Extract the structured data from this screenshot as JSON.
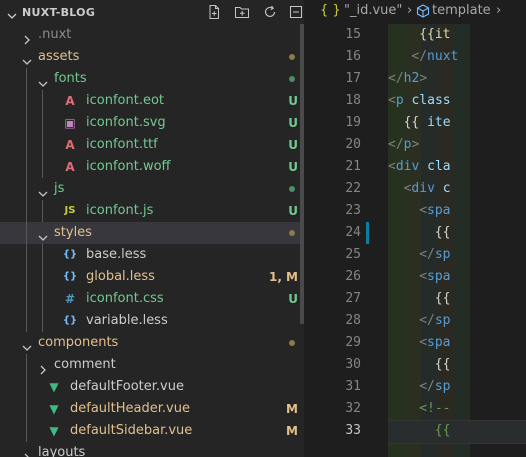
{
  "explorer": {
    "title": "NUXT-BLOG",
    "tree": [
      {
        "label": "nuxt",
        "prefix": ".",
        "depth": 0,
        "chevron": "right",
        "color": "#8c8c8c",
        "icon": null,
        "badge": "",
        "dot": null,
        "active": false
      },
      {
        "label": "assets",
        "depth": 0,
        "chevron": "down",
        "color": "#e2c08d",
        "icon": null,
        "badge": "",
        "dot": "#8c7a4a",
        "active": false
      },
      {
        "label": "fonts",
        "depth": 1,
        "chevron": "down",
        "color": "#73c991",
        "icon": null,
        "badge": "",
        "dot": "#4d8f63",
        "active": false
      },
      {
        "label": "iconfont.eot",
        "depth": 2,
        "chevron": null,
        "color": "#73c991",
        "icon": "font-file-icon",
        "badge": "U",
        "dot": null,
        "active": false
      },
      {
        "label": "iconfont.svg",
        "depth": 2,
        "chevron": null,
        "color": "#73c991",
        "icon": "svg-file-icon",
        "badge": "U",
        "dot": null,
        "active": false
      },
      {
        "label": "iconfont.ttf",
        "depth": 2,
        "chevron": null,
        "color": "#73c991",
        "icon": "font-file-icon",
        "badge": "U",
        "dot": null,
        "active": false
      },
      {
        "label": "iconfont.woff",
        "depth": 2,
        "chevron": null,
        "color": "#73c991",
        "icon": "font-file-icon",
        "badge": "U",
        "dot": null,
        "active": false
      },
      {
        "label": "js",
        "depth": 1,
        "chevron": "down",
        "color": "#73c991",
        "icon": null,
        "badge": "",
        "dot": "#4d8f63",
        "active": false
      },
      {
        "label": "iconfont.js",
        "depth": 2,
        "chevron": null,
        "color": "#73c991",
        "icon": "js-file-icon",
        "badge": "U",
        "dot": null,
        "active": false
      },
      {
        "label": "styles",
        "depth": 1,
        "chevron": "down",
        "color": "#e2c08d",
        "icon": null,
        "badge": "",
        "dot": "#8c7a4a",
        "active": true
      },
      {
        "label": "base.less",
        "depth": 2,
        "chevron": null,
        "color": "#cccccc",
        "icon": "less-file-icon",
        "badge": "",
        "dot": null,
        "active": false
      },
      {
        "label": "global.less",
        "depth": 2,
        "chevron": null,
        "color": "#e2c08d",
        "icon": "less-file-icon",
        "badge": "1, M",
        "dot": null,
        "active": false
      },
      {
        "label": "iconfont.css",
        "depth": 2,
        "chevron": null,
        "color": "#73c991",
        "icon": "css-file-icon",
        "badge": "U",
        "dot": null,
        "active": false
      },
      {
        "label": "variable.less",
        "depth": 2,
        "chevron": null,
        "color": "#cccccc",
        "icon": "less-file-icon",
        "badge": "",
        "dot": null,
        "active": false
      },
      {
        "label": "components",
        "depth": 0,
        "chevron": "down",
        "color": "#e2c08d",
        "icon": null,
        "badge": "",
        "dot": "#8c7a4a",
        "active": false
      },
      {
        "label": "comment",
        "depth": 1,
        "chevron": "right",
        "color": "#cccccc",
        "icon": null,
        "badge": "",
        "dot": null,
        "active": false
      },
      {
        "label": "defaultFooter.vue",
        "depth": 1,
        "chevron": null,
        "color": "#cccccc",
        "icon": "vue-file-icon",
        "badge": "",
        "dot": null,
        "active": false
      },
      {
        "label": "defaultHeader.vue",
        "depth": 1,
        "chevron": null,
        "color": "#e2c08d",
        "icon": "vue-file-icon",
        "badge": "M",
        "dot": null,
        "active": false
      },
      {
        "label": "defaultSidebar.vue",
        "depth": 1,
        "chevron": null,
        "color": "#e2c08d",
        "icon": "vue-file-icon",
        "badge": "M",
        "dot": null,
        "active": false
      },
      {
        "label": "layouts",
        "depth": 0,
        "chevron": "right",
        "color": "#cccccc",
        "icon": null,
        "badge": "",
        "dot": null,
        "active": false
      }
    ]
  },
  "editor": {
    "breadcrumb": {
      "file_icon": "{ }",
      "file": "\"_id.vue\"",
      "separator": "›",
      "node_icon": "cube-icon",
      "node": "template",
      "separator2": "›"
    },
    "lines": [
      {
        "n": "15",
        "indent": 4,
        "segs": [
          [
            "{{it",
            "#dcdcaa"
          ]
        ]
      },
      {
        "n": "16",
        "indent": 3,
        "segs": [
          [
            "</",
            "#808080"
          ],
          [
            "nuxt",
            "#569cd6"
          ]
        ]
      },
      {
        "n": "17",
        "indent": 0,
        "segs": [
          [
            "</",
            "#808080"
          ],
          [
            "h2",
            "#569cd6"
          ],
          [
            ">",
            "#808080"
          ]
        ]
      },
      {
        "n": "18",
        "indent": 0,
        "segs": [
          [
            "<",
            "#808080"
          ],
          [
            "p",
            "#569cd6"
          ],
          [
            " class",
            "#9cdcfe"
          ]
        ]
      },
      {
        "n": "19",
        "indent": 2,
        "segs": [
          [
            "{{",
            "#d4d4d4"
          ],
          [
            " ite",
            "#9cdcfe"
          ]
        ]
      },
      {
        "n": "20",
        "indent": 0,
        "segs": [
          [
            "</",
            "#808080"
          ],
          [
            "p",
            "#569cd6"
          ],
          [
            ">",
            "#808080"
          ]
        ]
      },
      {
        "n": "21",
        "indent": 0,
        "segs": [
          [
            "<",
            "#808080"
          ],
          [
            "div",
            "#569cd6"
          ],
          [
            " cla",
            "#9cdcfe"
          ]
        ]
      },
      {
        "n": "22",
        "indent": 2,
        "segs": [
          [
            "<",
            "#808080"
          ],
          [
            "div",
            "#569cd6"
          ],
          [
            " c",
            "#9cdcfe"
          ]
        ]
      },
      {
        "n": "23",
        "indent": 4,
        "segs": [
          [
            "<",
            "#808080"
          ],
          [
            "spa",
            "#569cd6"
          ]
        ]
      },
      {
        "n": "24",
        "indent": 6,
        "segs": [
          [
            "{{",
            "#d4d4d4"
          ]
        ]
      },
      {
        "n": "25",
        "indent": 4,
        "segs": [
          [
            "</",
            "#808080"
          ],
          [
            "sp",
            "#569cd6"
          ]
        ]
      },
      {
        "n": "26",
        "indent": 4,
        "segs": [
          [
            "<",
            "#808080"
          ],
          [
            "spa",
            "#569cd6"
          ]
        ]
      },
      {
        "n": "27",
        "indent": 6,
        "segs": [
          [
            "{{",
            "#d4d4d4"
          ]
        ]
      },
      {
        "n": "28",
        "indent": 4,
        "segs": [
          [
            "</",
            "#808080"
          ],
          [
            "sp",
            "#569cd6"
          ]
        ]
      },
      {
        "n": "29",
        "indent": 4,
        "segs": [
          [
            "<",
            "#808080"
          ],
          [
            "spa",
            "#569cd6"
          ]
        ]
      },
      {
        "n": "30",
        "indent": 6,
        "segs": [
          [
            "{{",
            "#d4d4d4"
          ]
        ]
      },
      {
        "n": "31",
        "indent": 4,
        "segs": [
          [
            "</",
            "#808080"
          ],
          [
            "sp",
            "#569cd6"
          ]
        ]
      },
      {
        "n": "32",
        "indent": 4,
        "segs": [
          [
            "<!--",
            "#6a9955"
          ]
        ]
      },
      {
        "n": "33",
        "indent": 6,
        "segs": [
          [
            "{{",
            "#6a9955"
          ]
        ]
      }
    ]
  },
  "colors": {
    "accent": "#007acc",
    "untracked": "#73c991",
    "modified": "#e2c08d",
    "tag": "#569cd6"
  }
}
